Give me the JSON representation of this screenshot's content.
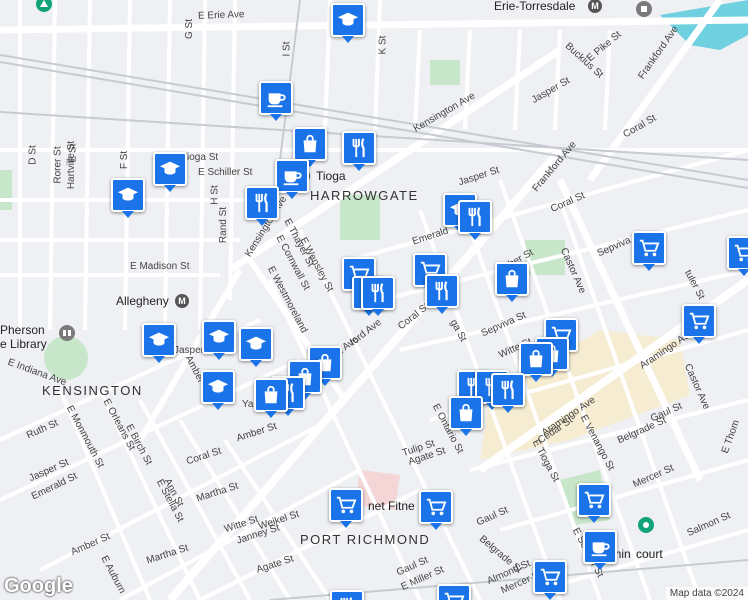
{
  "neighborhoods": {
    "harrowgate": "HARROWGATE",
    "kensington": "KENSINGTON",
    "port_richmond": "PORT RICHMOND"
  },
  "stations": {
    "erie_torresdale": "Erie-Torresdale",
    "tioga": "Tioga",
    "allegheny": "Allegheny"
  },
  "places": {
    "library_line1": "Pherson",
    "library_line2": "e Library",
    "fitness": "net Fitne",
    "badminton": "Badmin",
    "court": "court"
  },
  "streets": {
    "e_erie_ave": "E Erie Ave",
    "kensington_ave_ne": "Kensington Ave",
    "kensington_ave_sw": "Kensington Ave",
    "frankford_ave_top": "Frankford Ave",
    "frankford_ave_mid": "Frankford Ave",
    "ford_ave": "ford Ave",
    "aramingo_ave": "Aramingo Ave",
    "aramingo_ave_right": "Aramingo Ave",
    "castor_ave": "Castor Ave",
    "castor_ave_right": "Castor Ave",
    "e_tioga_st": "E Tioga St",
    "e_schiller_st": "E Schiller St",
    "e_madison_st": "E Madison St",
    "e_indiana_ave": "E Indiana Ave",
    "e_westmoreland": "E Westmoreland",
    "e_thayer_st": "E Thayer St",
    "e_wensley_st": "E Wensley St",
    "e_cornwall_st": "E Cornwall St",
    "jasper_st_top": "Jasper St",
    "jasper_st_mid": "Jasper St",
    "jasper_st_left": "Jasper",
    "jasper_st_bottom": "Jasper St",
    "coral_st_right": "Coral St",
    "coral_st_top": "Coral St",
    "coral_st_mid": "Coral St",
    "coral_st_bottom": "Coral St",
    "amber_st_mid": "Amber St",
    "amber_st_bottom": "Amber St",
    "emerald_st_mid": "Emerald",
    "emerald_st_bottom": "Emerald St",
    "sepviva_st": "Sepviva St",
    "sepviva_st_mid": "Sepviva St",
    "witte_st": "Witte St",
    "witte_st_bottom": "Witte St",
    "e_pike_st": "E Pike St",
    "buckius_st": "Buckius St",
    "d_st": "D St",
    "e_st": "E St",
    "f_st": "F St",
    "g_st": "G St",
    "h_st": "H St",
    "i_st": "I St",
    "k_st": "K St",
    "rand_st": "Rand St",
    "rorer_st": "Rorer St",
    "hartville_st": "Hartville St",
    "ruth_st": "Ruth St",
    "e_monmouth_st": "E Monmouth St",
    "e_orleans_st": "E Orleans St",
    "e_birch_st": "E Birch St",
    "amber_st_left": "Amber St",
    "ann_st": "Ann St",
    "e_stella_st": "E Stella St",
    "martha_st": "Martha St",
    "martha_st_bottom": "Martha St",
    "janney_st": "Janney St",
    "weikel_st": "Weikel St",
    "e_auburn": "E Auburn",
    "agate_st": "Agate St",
    "agate_st_mid": "Agate St",
    "tulip_st": "Tulip St",
    "e_ontario_st": "E Ontario St",
    "cedar_st": "Cedar St",
    "e_venango_st": "E Venango St",
    "e_tioga_st_lower": "E Tioga St",
    "belgrade_st": "Belgrade St",
    "belgrade_st_bottom": "Belgrade St",
    "gaul_st_right": "Gaul St",
    "gaul_st_mid": "Gaul St",
    "gaul_st_bottom": "Gaul St",
    "mercer_st": "Mercer St",
    "mercer_st_bottom": "Mercer St",
    "salmon_st": "Salmon St",
    "almond_st": "Almond St",
    "e_miller_st": "E Miller St",
    "e_schiller_st_bottom": "E Schiller St",
    "e_thom": "E Thom",
    "tuler_st": "tuler St",
    "yan": "Yan",
    "ga_st": "ga St",
    "bar_st": "ber St",
    "rford_ave": "rford Ave"
  },
  "markers": [
    {
      "type": "school",
      "icon": "school-icon"
    },
    {
      "type": "cafe",
      "icon": "coffee-icon"
    },
    {
      "type": "shop",
      "icon": "shopping-bag-icon"
    },
    {
      "type": "restaurant",
      "icon": "restaurant-icon"
    },
    {
      "type": "cafe",
      "icon": "coffee-icon"
    },
    {
      "type": "school",
      "icon": "school-icon"
    },
    {
      "type": "school",
      "icon": "school-icon"
    },
    {
      "type": "restaurant",
      "icon": "restaurant-icon"
    },
    {
      "type": "school",
      "icon": "school-icon"
    },
    {
      "type": "restaurant",
      "icon": "restaurant-icon"
    },
    {
      "type": "grocery",
      "icon": "shopping-cart-icon"
    },
    {
      "type": "grocery",
      "icon": "shopping-cart-icon"
    },
    {
      "type": "restaurant",
      "icon": "restaurant-icon"
    },
    {
      "type": "restaurant",
      "icon": "restaurant-icon"
    },
    {
      "type": "restaurant",
      "icon": "restaurant-icon"
    },
    {
      "type": "shop",
      "icon": "shopping-bag-icon"
    },
    {
      "type": "grocery",
      "icon": "shopping-cart-icon"
    },
    {
      "type": "grocery",
      "icon": "shopping-cart-icon"
    },
    {
      "type": "grocery",
      "icon": "shopping-cart-icon"
    },
    {
      "type": "school",
      "icon": "school-icon"
    },
    {
      "type": "school",
      "icon": "school-icon"
    },
    {
      "type": "school",
      "icon": "school-icon"
    },
    {
      "type": "school",
      "icon": "school-icon"
    },
    {
      "type": "shop",
      "icon": "shopping-bag-icon"
    },
    {
      "type": "shop",
      "icon": "shopping-bag-icon"
    },
    {
      "type": "restaurant",
      "icon": "restaurant-icon"
    },
    {
      "type": "shop",
      "icon": "shopping-bag-icon"
    },
    {
      "type": "grocery",
      "icon": "shopping-cart-icon"
    },
    {
      "type": "shop",
      "icon": "shopping-bag-icon"
    },
    {
      "type": "shop",
      "icon": "shopping-bag-icon"
    },
    {
      "type": "restaurant",
      "icon": "restaurant-icon"
    },
    {
      "type": "restaurant",
      "icon": "restaurant-icon"
    },
    {
      "type": "restaurant",
      "icon": "restaurant-icon"
    },
    {
      "type": "shop",
      "icon": "shopping-bag-icon"
    },
    {
      "type": "grocery",
      "icon": "shopping-cart-icon"
    },
    {
      "type": "grocery",
      "icon": "shopping-cart-icon"
    },
    {
      "type": "grocery",
      "icon": "shopping-cart-icon"
    },
    {
      "type": "cafe",
      "icon": "coffee-icon"
    },
    {
      "type": "grocery",
      "icon": "shopping-cart-icon"
    },
    {
      "type": "grocery",
      "icon": "shopping-cart-icon"
    },
    {
      "type": "restaurant",
      "icon": "restaurant-icon"
    }
  ],
  "branding": {
    "logo": "Google",
    "attribution": "Map data ©2024"
  },
  "colors": {
    "marker": "#1a73e8",
    "park": "#c8e6c9",
    "commercial": "#f6ecd2",
    "water": "#6fd0e0",
    "transit": "#555555"
  }
}
